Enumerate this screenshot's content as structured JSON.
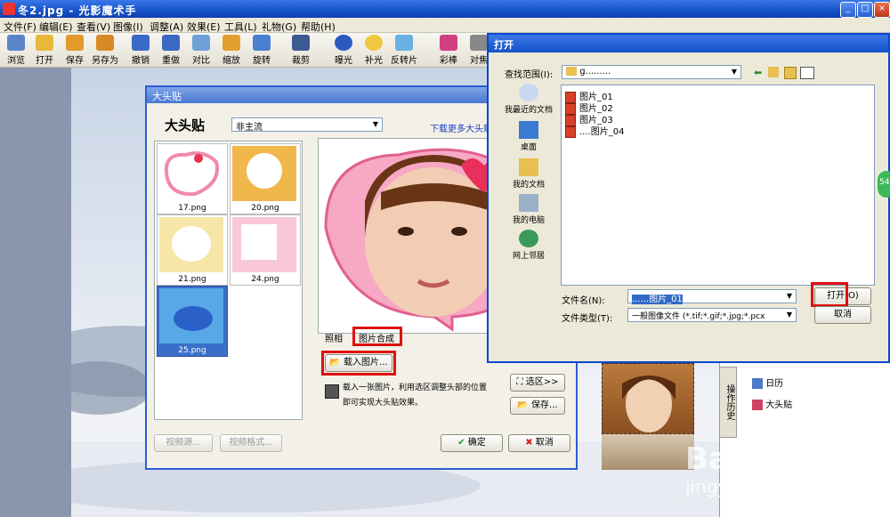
{
  "app": {
    "title": "冬2.jpg - 光影魔术手"
  },
  "menu": [
    "文件(F)",
    "编辑(E)",
    "查看(V)",
    "图像(I)",
    "调整(A)",
    "效果(E)",
    "工具(L)",
    "礼物(G)",
    "帮助(H)"
  ],
  "toolbar": [
    "浏览",
    "打开",
    "保存",
    "另存为",
    "撤销",
    "重做",
    "对比",
    "缩放",
    "旋转",
    "裁剪",
    "曝光",
    "补光",
    "反转片",
    "彩棒",
    "对焦"
  ],
  "sticker_dialog": {
    "title": "大头贴",
    "heading": "大头贴",
    "style_value": "非主流",
    "download_link": "下载更多大头贴",
    "thumbs": [
      "17.png",
      "20.png",
      "21.png",
      "24.png",
      "25.png"
    ],
    "tab_photo": "照相",
    "tab_compose": "图片合成",
    "load_btn": "载入图片...",
    "select_btn": "选区>>",
    "save_btn": "保存...",
    "hint_line1": "载入一张图片，利用选区调整头部的位置",
    "hint_line2": "即可实现大头贴效果。",
    "video_src_btn": "视频源...",
    "video_fmt_btn": "视频格式...",
    "ok_btn": "确定",
    "cancel_btn": "取消"
  },
  "open_dialog": {
    "title": "打开",
    "lookin_label": "查找范围(I):",
    "lookin_value": "g.........",
    "places": [
      "我最近的文档",
      "桌面",
      "我的文档",
      "我的电脑",
      "网上邻居"
    ],
    "files": [
      "图片_01",
      "图片_02",
      "图片_03",
      "....图片_04"
    ],
    "filename_label": "文件名(N):",
    "filename_value": "......图片_01",
    "filetype_label": "文件类型(T):",
    "filetype_value": "一般图像文件 (*.tif;*.gif;*.jpg;*.pcx",
    "open_btn": "打开(O)",
    "cancel_btn": "取消"
  },
  "history": {
    "tab": "操作历史",
    "items": [
      "日历",
      "大头贴"
    ]
  },
  "watermark": {
    "brand": "Baidu经验",
    "url": "jingyan.baidu.com"
  }
}
